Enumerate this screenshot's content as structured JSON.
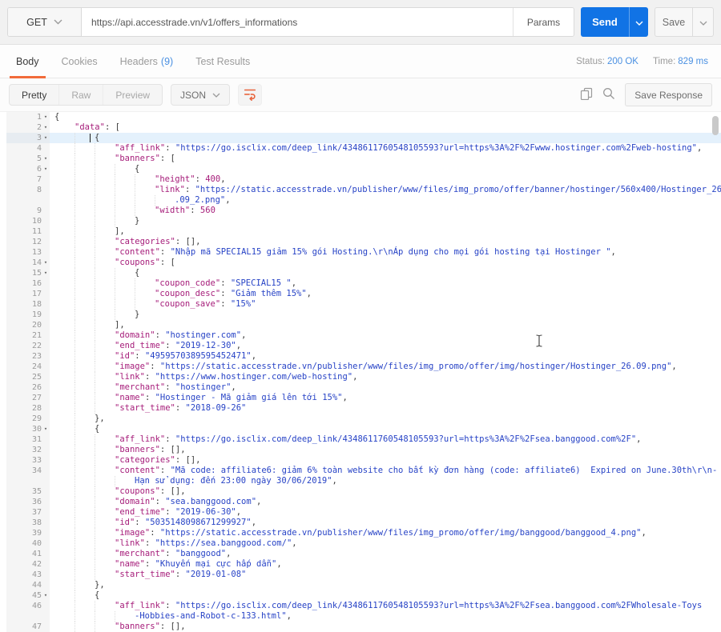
{
  "colors": {
    "accent_orange": "#F26B3A",
    "send_blue": "#1173E5",
    "link_blue": "#4A90E2",
    "key": "#A61D7A",
    "string": "#2743C6",
    "number": "#A61D7A",
    "row_highlight": "#E4F1FC"
  },
  "icons": {
    "method_chevron": "chevron-down",
    "send_chevron": "chevron-down",
    "save_chevron": "chevron-down",
    "format_chevron": "chevron-down",
    "wrap": "wrap-text",
    "copy": "copy-pages",
    "search": "magnifier",
    "fold": "triangle-down",
    "mouse": "i-beam-cursor"
  },
  "request": {
    "method": "GET",
    "url": "https://api.accesstrade.vn/v1/offers_informations",
    "params_label": "Params",
    "send_label": "Send",
    "save_label": "Save"
  },
  "tabs": {
    "body": "Body",
    "cookies": "Cookies",
    "headers": "Headers",
    "headers_count": "(9)",
    "test_results": "Test Results",
    "status_label": "Status:",
    "status_value": "200 OK",
    "time_label": "Time:",
    "time_value": "829 ms"
  },
  "toolbar": {
    "pretty": "Pretty",
    "raw": "Raw",
    "preview": "Preview",
    "format": "JSON",
    "save_response": "Save Response"
  },
  "code": {
    "rows": [
      {
        "n": "1",
        "f": true,
        "i": 0,
        "segs": [
          [
            "p",
            "{"
          ]
        ]
      },
      {
        "n": "2",
        "f": true,
        "i": 1,
        "segs": [
          [
            "k",
            "\"data\""
          ],
          [
            "p",
            ": ["
          ]
        ]
      },
      {
        "n": "3",
        "f": true,
        "i": 2,
        "hl": true,
        "caret": true,
        "segs": [
          [
            "p",
            "{"
          ]
        ]
      },
      {
        "n": "4",
        "i": 3,
        "segs": [
          [
            "k",
            "\"aff_link\""
          ],
          [
            "p",
            ": "
          ],
          [
            "s",
            "\"https://go.isclix.com/deep_link/4348611760548105593?url=https%3A%2F%2Fwww.hostinger.com%2Fweb-hosting\""
          ],
          [
            "p",
            ","
          ]
        ]
      },
      {
        "n": "5",
        "f": true,
        "i": 3,
        "segs": [
          [
            "k",
            "\"banners\""
          ],
          [
            "p",
            ": ["
          ]
        ]
      },
      {
        "n": "6",
        "f": true,
        "i": 4,
        "segs": [
          [
            "p",
            "{"
          ]
        ]
      },
      {
        "n": "7",
        "i": 5,
        "segs": [
          [
            "k",
            "\"height\""
          ],
          [
            "p",
            ": "
          ],
          [
            "n",
            "400"
          ],
          [
            "p",
            ","
          ]
        ]
      },
      {
        "n": "8",
        "i": 5,
        "segs": [
          [
            "k",
            "\"link\""
          ],
          [
            "p",
            ": "
          ],
          [
            "s",
            "\"https://static.accesstrade.vn/publisher/www/files/img_promo/offer/banner/hostinger/560x400/Hostinger_26"
          ]
        ]
      },
      {
        "n": "",
        "i": 6,
        "segs": [
          [
            "s",
            ".09_2.png\""
          ],
          [
            "p",
            ","
          ]
        ]
      },
      {
        "n": "9",
        "i": 5,
        "segs": [
          [
            "k",
            "\"width\""
          ],
          [
            "p",
            ": "
          ],
          [
            "n",
            "560"
          ]
        ]
      },
      {
        "n": "10",
        "i": 4,
        "segs": [
          [
            "p",
            "}"
          ]
        ]
      },
      {
        "n": "11",
        "i": 3,
        "segs": [
          [
            "p",
            "],"
          ]
        ]
      },
      {
        "n": "12",
        "i": 3,
        "segs": [
          [
            "k",
            "\"categories\""
          ],
          [
            "p",
            ": [],"
          ]
        ]
      },
      {
        "n": "13",
        "i": 3,
        "segs": [
          [
            "k",
            "\"content\""
          ],
          [
            "p",
            ": "
          ],
          [
            "s",
            "\"Nhập mã SPECIAL15 giảm 15% gói Hosting.\\r\\nÁp dụng cho mọi gói hosting tại Hostinger \""
          ],
          [
            "p",
            ","
          ]
        ]
      },
      {
        "n": "14",
        "f": true,
        "i": 3,
        "segs": [
          [
            "k",
            "\"coupons\""
          ],
          [
            "p",
            ": ["
          ]
        ]
      },
      {
        "n": "15",
        "f": true,
        "i": 4,
        "segs": [
          [
            "p",
            "{"
          ]
        ]
      },
      {
        "n": "16",
        "i": 5,
        "segs": [
          [
            "k",
            "\"coupon_code\""
          ],
          [
            "p",
            ": "
          ],
          [
            "s",
            "\"SPECIAL15 \""
          ],
          [
            "p",
            ","
          ]
        ]
      },
      {
        "n": "17",
        "i": 5,
        "segs": [
          [
            "k",
            "\"coupon_desc\""
          ],
          [
            "p",
            ": "
          ],
          [
            "s",
            "\"Giảm thêm 15%\""
          ],
          [
            "p",
            ","
          ]
        ]
      },
      {
        "n": "18",
        "i": 5,
        "segs": [
          [
            "k",
            "\"coupon_save\""
          ],
          [
            "p",
            ": "
          ],
          [
            "s",
            "\"15%\""
          ]
        ]
      },
      {
        "n": "19",
        "i": 4,
        "segs": [
          [
            "p",
            "}"
          ]
        ]
      },
      {
        "n": "20",
        "i": 3,
        "segs": [
          [
            "p",
            "],"
          ]
        ]
      },
      {
        "n": "21",
        "i": 3,
        "segs": [
          [
            "k",
            "\"domain\""
          ],
          [
            "p",
            ": "
          ],
          [
            "s",
            "\"hostinger.com\""
          ],
          [
            "p",
            ","
          ]
        ]
      },
      {
        "n": "22",
        "i": 3,
        "segs": [
          [
            "k",
            "\"end_time\""
          ],
          [
            "p",
            ": "
          ],
          [
            "s",
            "\"2019-12-30\""
          ],
          [
            "p",
            ","
          ]
        ]
      },
      {
        "n": "23",
        "i": 3,
        "segs": [
          [
            "k",
            "\"id\""
          ],
          [
            "p",
            ": "
          ],
          [
            "s",
            "\"4959570389595452471\""
          ],
          [
            "p",
            ","
          ]
        ]
      },
      {
        "n": "24",
        "i": 3,
        "segs": [
          [
            "k",
            "\"image\""
          ],
          [
            "p",
            ": "
          ],
          [
            "s",
            "\"https://static.accesstrade.vn/publisher/www/files/img_promo/offer/img/hostinger/Hostinger_26.09.png\""
          ],
          [
            "p",
            ","
          ]
        ]
      },
      {
        "n": "25",
        "i": 3,
        "segs": [
          [
            "k",
            "\"link\""
          ],
          [
            "p",
            ": "
          ],
          [
            "s",
            "\"https://www.hostinger.com/web-hosting\""
          ],
          [
            "p",
            ","
          ]
        ]
      },
      {
        "n": "26",
        "i": 3,
        "segs": [
          [
            "k",
            "\"merchant\""
          ],
          [
            "p",
            ": "
          ],
          [
            "s",
            "\"hostinger\""
          ],
          [
            "p",
            ","
          ]
        ]
      },
      {
        "n": "27",
        "i": 3,
        "segs": [
          [
            "k",
            "\"name\""
          ],
          [
            "p",
            ": "
          ],
          [
            "s",
            "\"Hostinger - Mã giảm giá lên tới 15%\""
          ],
          [
            "p",
            ","
          ]
        ]
      },
      {
        "n": "28",
        "i": 3,
        "segs": [
          [
            "k",
            "\"start_time\""
          ],
          [
            "p",
            ": "
          ],
          [
            "s",
            "\"2018-09-26\""
          ]
        ]
      },
      {
        "n": "29",
        "i": 2,
        "segs": [
          [
            "p",
            "},"
          ]
        ]
      },
      {
        "n": "30",
        "f": true,
        "i": 2,
        "segs": [
          [
            "p",
            "{"
          ]
        ]
      },
      {
        "n": "31",
        "i": 3,
        "segs": [
          [
            "k",
            "\"aff_link\""
          ],
          [
            "p",
            ": "
          ],
          [
            "s",
            "\"https://go.isclix.com/deep_link/4348611760548105593?url=https%3A%2F%2Fsea.banggood.com%2F\""
          ],
          [
            "p",
            ","
          ]
        ]
      },
      {
        "n": "32",
        "i": 3,
        "segs": [
          [
            "k",
            "\"banners\""
          ],
          [
            "p",
            ": [],"
          ]
        ]
      },
      {
        "n": "33",
        "i": 3,
        "segs": [
          [
            "k",
            "\"categories\""
          ],
          [
            "p",
            ": [],"
          ]
        ]
      },
      {
        "n": "34",
        "i": 3,
        "segs": [
          [
            "k",
            "\"content\""
          ],
          [
            "p",
            ": "
          ],
          [
            "s",
            "\"Mã code: affiliate6: giảm 6% toàn website cho bất kỳ đơn hàng (code: affiliate6)  Expired on June.30th\\r\\n-"
          ]
        ]
      },
      {
        "n": "",
        "i": 4,
        "segs": [
          [
            "s",
            "Hạn sử dụng: đến 23:00 ngày 30/06/2019\""
          ],
          [
            "p",
            ","
          ]
        ]
      },
      {
        "n": "35",
        "i": 3,
        "segs": [
          [
            "k",
            "\"coupons\""
          ],
          [
            "p",
            ": [],"
          ]
        ]
      },
      {
        "n": "36",
        "i": 3,
        "segs": [
          [
            "k",
            "\"domain\""
          ],
          [
            "p",
            ": "
          ],
          [
            "s",
            "\"sea.banggood.com\""
          ],
          [
            "p",
            ","
          ]
        ]
      },
      {
        "n": "37",
        "i": 3,
        "segs": [
          [
            "k",
            "\"end_time\""
          ],
          [
            "p",
            ": "
          ],
          [
            "s",
            "\"2019-06-30\""
          ],
          [
            "p",
            ","
          ]
        ]
      },
      {
        "n": "38",
        "i": 3,
        "segs": [
          [
            "k",
            "\"id\""
          ],
          [
            "p",
            ": "
          ],
          [
            "s",
            "\"5035148098671299927\""
          ],
          [
            "p",
            ","
          ]
        ]
      },
      {
        "n": "39",
        "i": 3,
        "segs": [
          [
            "k",
            "\"image\""
          ],
          [
            "p",
            ": "
          ],
          [
            "s",
            "\"https://static.accesstrade.vn/publisher/www/files/img_promo/offer/img/banggood/banggood_4.png\""
          ],
          [
            "p",
            ","
          ]
        ]
      },
      {
        "n": "40",
        "i": 3,
        "segs": [
          [
            "k",
            "\"link\""
          ],
          [
            "p",
            ": "
          ],
          [
            "s",
            "\"https://sea.banggood.com/\""
          ],
          [
            "p",
            ","
          ]
        ]
      },
      {
        "n": "41",
        "i": 3,
        "segs": [
          [
            "k",
            "\"merchant\""
          ],
          [
            "p",
            ": "
          ],
          [
            "s",
            "\"banggood\""
          ],
          [
            "p",
            ","
          ]
        ]
      },
      {
        "n": "42",
        "i": 3,
        "segs": [
          [
            "k",
            "\"name\""
          ],
          [
            "p",
            ": "
          ],
          [
            "s",
            "\"Khuyến mại cực hấp dẫn\""
          ],
          [
            "p",
            ","
          ]
        ]
      },
      {
        "n": "43",
        "i": 3,
        "segs": [
          [
            "k",
            "\"start_time\""
          ],
          [
            "p",
            ": "
          ],
          [
            "s",
            "\"2019-01-08\""
          ]
        ]
      },
      {
        "n": "44",
        "i": 2,
        "segs": [
          [
            "p",
            "},"
          ]
        ]
      },
      {
        "n": "45",
        "f": true,
        "i": 2,
        "segs": [
          [
            "p",
            "{"
          ]
        ]
      },
      {
        "n": "46",
        "i": 3,
        "segs": [
          [
            "k",
            "\"aff_link\""
          ],
          [
            "p",
            ": "
          ],
          [
            "s",
            "\"https://go.isclix.com/deep_link/4348611760548105593?url=https%3A%2F%2Fsea.banggood.com%2FWholesale-Toys"
          ]
        ]
      },
      {
        "n": "",
        "i": 4,
        "segs": [
          [
            "s",
            "-Hobbies-and-Robot-c-133.html\""
          ],
          [
            "p",
            ","
          ]
        ]
      },
      {
        "n": "47",
        "i": 3,
        "segs": [
          [
            "k",
            "\"banners\""
          ],
          [
            "p",
            ": [],"
          ]
        ]
      }
    ]
  }
}
